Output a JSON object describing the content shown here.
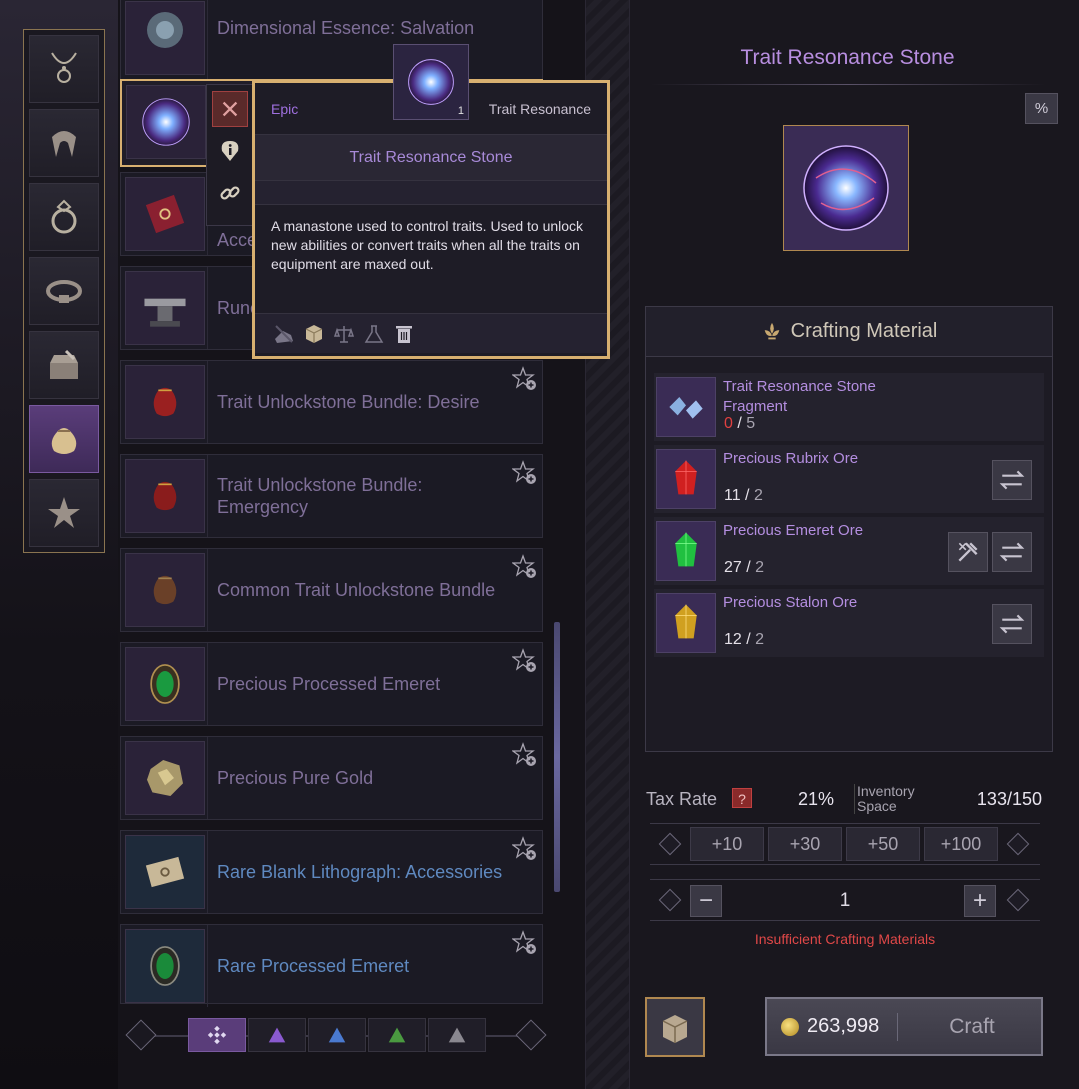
{
  "categories": [
    {
      "icon": "necklace-icon"
    },
    {
      "icon": "cloak-icon"
    },
    {
      "icon": "ring-icon"
    },
    {
      "icon": "belt-icon"
    },
    {
      "icon": "chest-icon"
    },
    {
      "icon": "pouch-icon",
      "active": true
    },
    {
      "icon": "star-icon"
    }
  ],
  "list": {
    "items": [
      {
        "name": "Dimensional Essence: Salvation",
        "icon": "essence-icon"
      },
      {
        "name": "",
        "icon": "trait-stone-icon"
      },
      {
        "name": "Acce",
        "icon": "scroll-icon"
      },
      {
        "name": "Rune",
        "icon": "anvil-icon"
      },
      {
        "name": "Trait Unlockstone Bundle: Desire",
        "icon": "bundle-icon"
      },
      {
        "name": "Trait Unlockstone Bundle: Emergency",
        "icon": "bundle-icon"
      },
      {
        "name": "Common Trait Unlockstone Bundle",
        "icon": "bundle-icon"
      },
      {
        "name": "Precious Processed Emeret",
        "icon": "emerald-icon"
      },
      {
        "name": "Precious Pure Gold",
        "icon": "gold-ore-icon"
      },
      {
        "name": "Rare Blank Lithograph: Accessories",
        "icon": "scroll-icon"
      },
      {
        "name": "Rare Processed Emeret",
        "icon": "emerald-icon"
      }
    ]
  },
  "tooltip": {
    "rarity": "Epic",
    "type": "Trait Resonance",
    "title": "Trait Resonance Stone",
    "description": "A manastone used to control traits. Used to unlock new abilities or convert traits when all the traits on equipment are maxed out.",
    "quantity": "1"
  },
  "detail": {
    "title": "Trait Resonance Stone",
    "percent_label": "%",
    "crafting_header": "Crafting Material",
    "materials": [
      {
        "name": "Trait Resonance Stone Fragment",
        "have": "0",
        "need": "5",
        "insufficient": true
      },
      {
        "name": "Precious Rubrix Ore",
        "have": "11",
        "need": "2"
      },
      {
        "name": "Precious Emeret Ore",
        "have": "27",
        "need": "2"
      },
      {
        "name": "Precious Stalon Ore",
        "have": "12",
        "need": "2"
      }
    ],
    "tax_label": "Tax Rate",
    "tax_help": "?",
    "tax_rate": "21%",
    "inventory_label": "Inventory Space",
    "inventory_value": "133/150",
    "increments": [
      "+10",
      "+30",
      "+50",
      "+100"
    ],
    "quantity": "1",
    "minus": "−",
    "plus": "+",
    "warning": "Insufficient Crafting Materials",
    "cost": "263,998",
    "craft_label": "Craft"
  },
  "colors": {
    "epic": "#a070e0",
    "gold_border": "#d8b070",
    "warning": "#e04848"
  }
}
